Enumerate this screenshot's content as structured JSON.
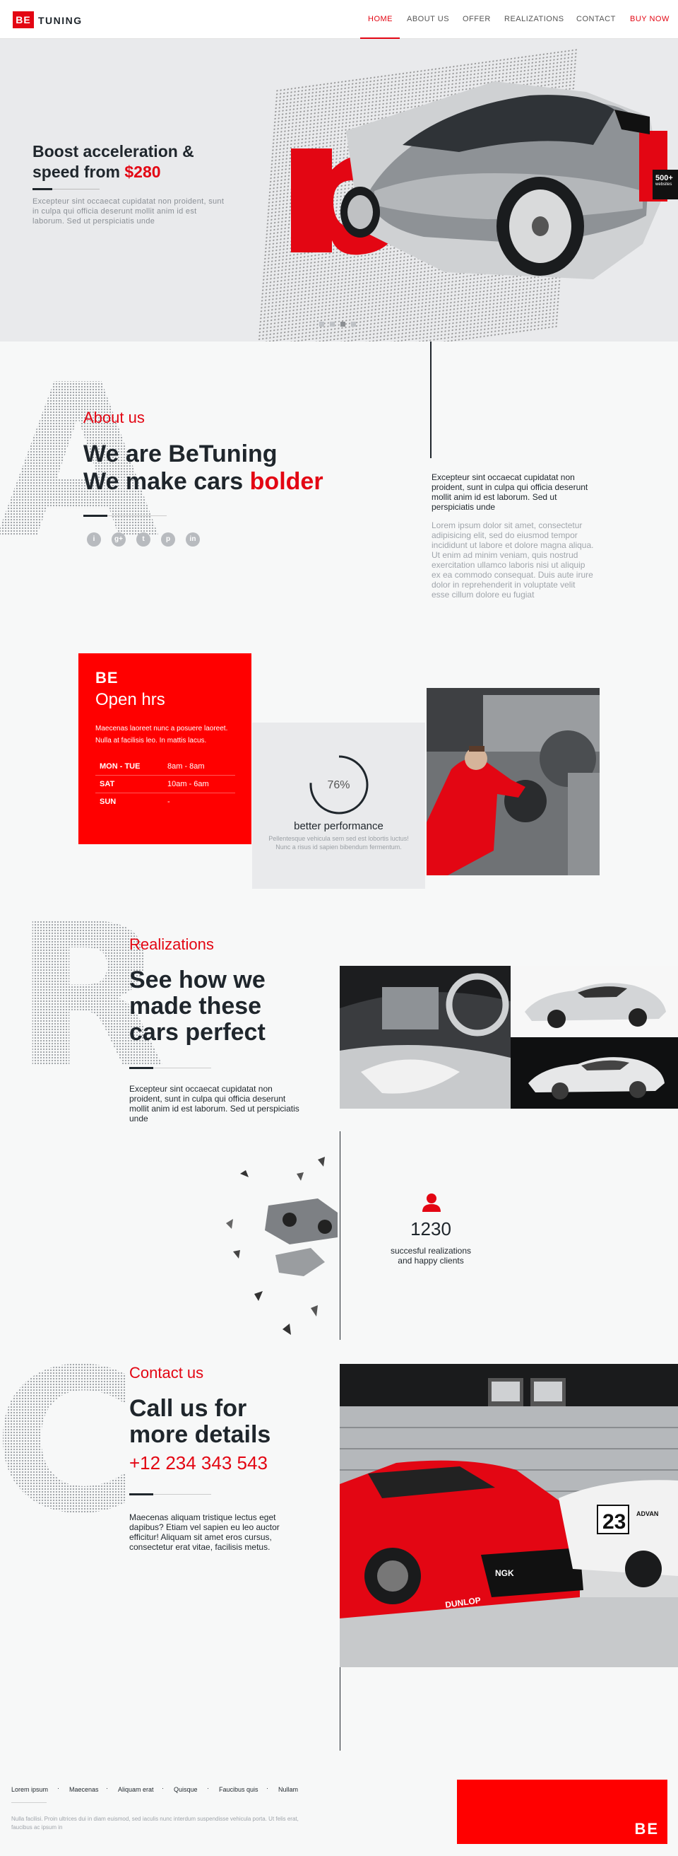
{
  "brand": {
    "logo_mark": "BE",
    "logo_text": "TUNING"
  },
  "nav": {
    "items": [
      "HOME",
      "ABOUT US",
      "OFFER",
      "REALIZATIONS",
      "CONTACT",
      "BUY NOW"
    ],
    "active": "HOME"
  },
  "hero": {
    "title_line1": "Boost acceleration &",
    "title_line2": "speed from ",
    "price": "$280",
    "text": "Excepteur sint occaecat cupidatat non proident, sunt in culpa qui officia deserunt mollit anim id est laborum. Sed ut perspiciatis unde",
    "badge_main": "500+",
    "badge_sub": "websites",
    "slider": {
      "count": 4,
      "active_index": 2
    }
  },
  "about": {
    "bg_letter": "A",
    "label": "About us",
    "title_line1": "We are BeTuning",
    "title_line2": "We make cars ",
    "title_highlight": "bolder",
    "social_icons": [
      "info-icon",
      "google-plus-icon",
      "twitter-icon",
      "pinterest-icon",
      "linkedin-icon"
    ],
    "lead": "Excepteur sint occaecat cupidatat non proident, sunt in culpa qui officia deserunt mollit anim id est laborum. Sed ut perspiciatis unde",
    "text": "Lorem ipsum dolor sit amet, consectetur adipisicing elit, sed do eiusmod tempor incididunt ut labore et dolore magna aliqua. Ut enim ad minim veniam, quis nostrud exercitation ullamco laboris nisi ut aliquip ex ea commodo consequat. Duis aute irure dolor in reprehenderit in voluptate velit esse cillum dolore eu fugiat"
  },
  "hours": {
    "logo": "BE",
    "title": "Open hrs",
    "desc": "Maecenas laoreet nunc a posuere laoreet. Nulla at facilisis leo. In mattis lacus.",
    "rows": [
      {
        "day": "MON - TUE",
        "time": "8am - 8am"
      },
      {
        "day": "SAT",
        "time": "10am - 6am"
      },
      {
        "day": "SUN",
        "time": "-"
      }
    ]
  },
  "performance": {
    "value_label": "76%",
    "value": 0.76,
    "title": "better performance",
    "text": "Pellentesque vehicula sem sed est lobortis luctus! Nunc a risus id sapien bibendum fermentum."
  },
  "realizations": {
    "bg_letter": "R",
    "label": "Realizations",
    "title": [
      "See how we",
      "made these",
      "cars perfect"
    ],
    "text": "Excepteur sint occaecat cupidatat non proident, sunt in culpa qui officia deserunt mollit anim id est laborum. Sed ut perspiciatis unde",
    "stat_icon": "user-icon",
    "stat_number": "1230",
    "stat_label_1": "succesful realizations",
    "stat_label_2": "and happy clients"
  },
  "contact": {
    "bg_letter": "C",
    "label": "Contact us",
    "title": [
      "Call us for",
      "more details"
    ],
    "phone": "+12 234 343 543",
    "text": "Maecenas aliquam tristique lectus eget dapibus? Etiam vel sapien eu leo auctor efficitur! Aliquam sit amet eros cursus, consectetur erat vitae, facilisis metus.",
    "photo_texts": [
      "NGK",
      "23",
      "DUNLOP",
      "ADVAN"
    ]
  },
  "footer": {
    "links": [
      "Lorem ipsum",
      "Maecenas",
      "Aliquam erat",
      "Quisque",
      "Faucibus quis",
      "Nullam"
    ],
    "separator": "·",
    "small": "Nulla facilisi. Proin ultrices dui in diam euismod, sed iaculis nunc interdum suspendisse vehicula porta. Ut felis erat, faucibus ac ipsum in",
    "logo": "BE"
  },
  "colors": {
    "accent": "#e30613",
    "dark": "#1f262c",
    "muted": "#a0a5ab"
  }
}
